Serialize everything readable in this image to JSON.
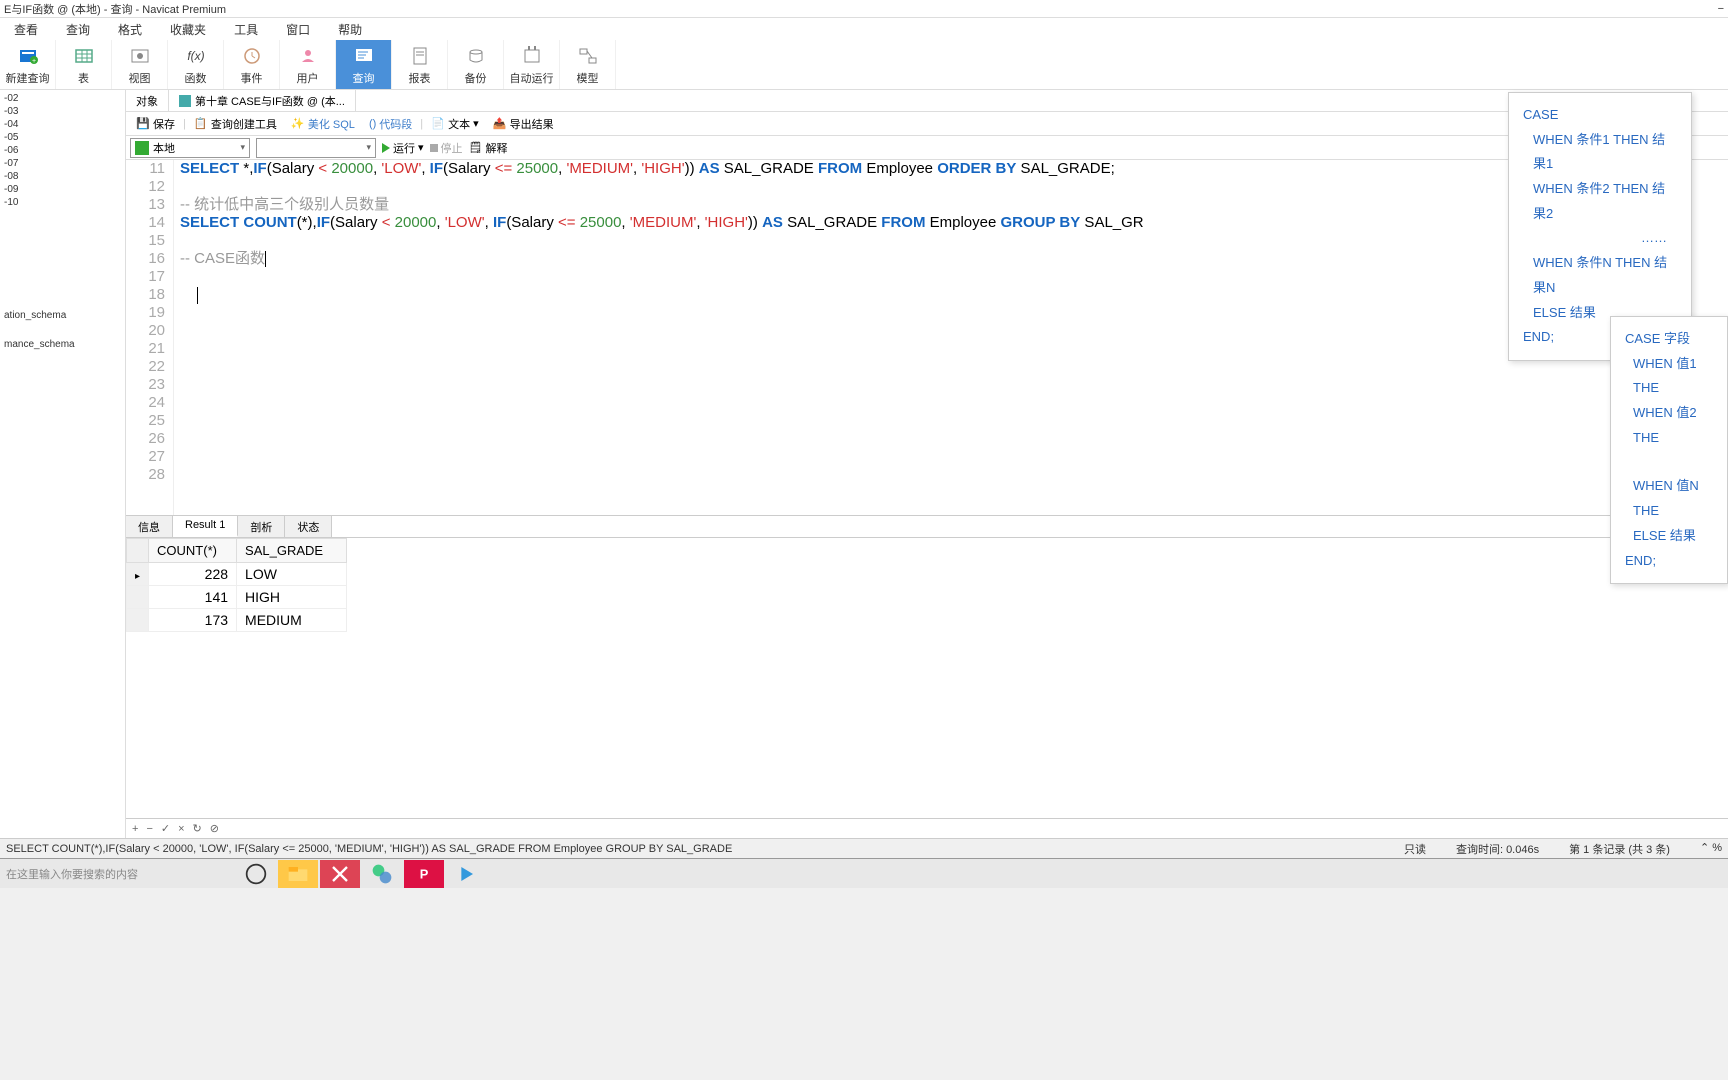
{
  "title": "E与IF函数 @ (本地) - 查询 - Navicat Premium",
  "menu": [
    "查看",
    "查询",
    "格式",
    "收藏夹",
    "工具",
    "窗口",
    "帮助"
  ],
  "toolbar": [
    {
      "label": "新建查询",
      "color": "#1976d2"
    },
    {
      "label": "表",
      "color": "#5a8"
    },
    {
      "label": "视图",
      "color": "#888"
    },
    {
      "label": "函数",
      "color": "#444"
    },
    {
      "label": "事件",
      "color": "#c97"
    },
    {
      "label": "用户",
      "color": "#e8a"
    },
    {
      "label": "查询",
      "color": "#4a90d9",
      "active": true
    },
    {
      "label": "报表",
      "color": "#888"
    },
    {
      "label": "备份",
      "color": "#888"
    },
    {
      "label": "自动运行",
      "color": "#888"
    },
    {
      "label": "模型",
      "color": "#888"
    }
  ],
  "left_items": [
    "-02",
    "-03",
    "-04",
    "-05",
    "-06",
    "-07",
    "-08",
    "-09",
    "-10",
    "",
    "",
    "",
    "",
    "",
    "ation_schema",
    "",
    "mance_schema"
  ],
  "tabs": [
    {
      "label": "对象"
    },
    {
      "label": "第十章 CASE与IF函数 @ (本...",
      "active": true
    }
  ],
  "sub_toolbar": {
    "save": "保存",
    "query_builder": "查询创建工具",
    "beautify": "美化 SQL",
    "snippet": "代码段",
    "text": "文本",
    "export": "导出结果"
  },
  "run_bar": {
    "conn": "本地",
    "run": "运行",
    "stop": "停止",
    "explain": "解释"
  },
  "code_lines_start": 11,
  "code_lines": 18,
  "code": {
    "l11": "SELECT *,IF(Salary < 20000, 'LOW', IF(Salary <= 25000, 'MEDIUM', 'HIGH')) AS SAL_GRADE FROM Employee ORDER BY SAL_GRADE;",
    "l13": "-- 统计低中高三个级别人员数量",
    "l14": "SELECT COUNT(*),IF(Salary < 20000, 'LOW', IF(Salary <= 25000, 'MEDIUM', 'HIGH')) AS SAL_GRADE FROM Employee GROUP BY SAL_GR",
    "l16": "-- CASE函数"
  },
  "result_tabs": [
    "信息",
    "Result 1",
    "剖析",
    "状态"
  ],
  "result_active_tab": 1,
  "result_cols": [
    "COUNT(*)",
    "SAL_GRADE"
  ],
  "result_rows": [
    {
      "count": "228",
      "grade": "LOW",
      "active": true
    },
    {
      "count": "141",
      "grade": "HIGH"
    },
    {
      "count": "173",
      "grade": "MEDIUM"
    }
  ],
  "result_footer_icons": [
    "+",
    "−",
    "✓",
    "×",
    "↻",
    "⊘"
  ],
  "status": {
    "sql": "SELECT COUNT(*),IF(Salary < 20000, 'LOW', IF(Salary <= 25000, 'MEDIUM', 'HIGH')) AS SAL_GRADE FROM Employee GROUP BY SAL_GRADE",
    "readonly": "只读",
    "time": "查询时间: 0.046s",
    "records": "第 1 条记录 (共 3 条)"
  },
  "taskbar": {
    "search": "在这里输入你要搜索的内容"
  },
  "popup1": [
    "CASE",
    "WHEN 条件1 THEN 结果1",
    "WHEN 条件2 THEN 结果2",
    "……",
    "WHEN 条件N THEN 结果N",
    "ELSE 结果",
    "END;"
  ],
  "popup2": [
    "CASE 字段",
    "WHEN 值1 THE",
    "WHEN 值2 THE",
    "",
    "WHEN 值N THE",
    "ELSE 结果",
    "END;"
  ]
}
